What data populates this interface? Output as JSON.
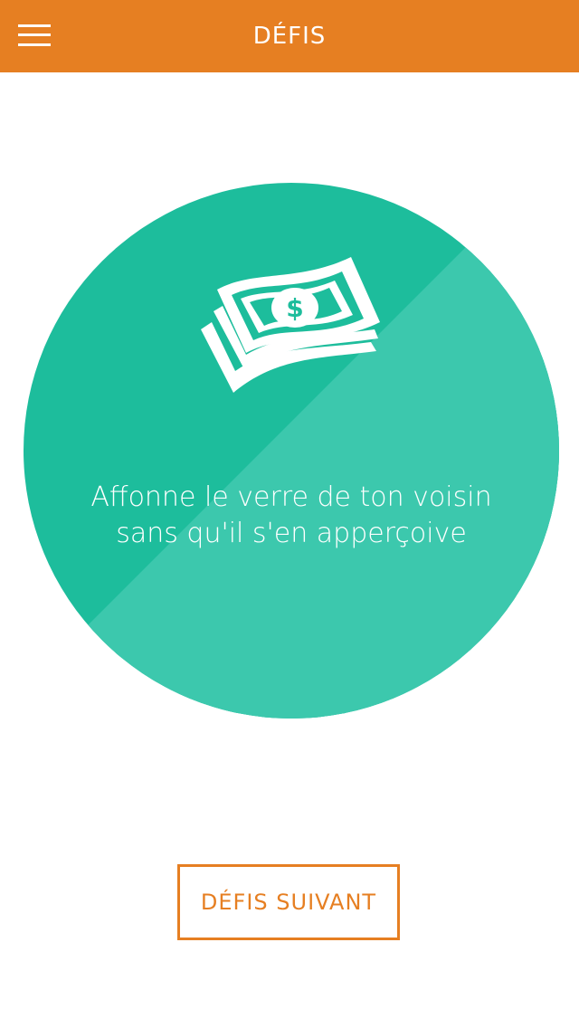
{
  "header": {
    "title": "DÉFIS",
    "menu_icon": "hamburger-menu-icon",
    "background_color": "#e67f22"
  },
  "challenge": {
    "icon": "money-bills-icon",
    "text": "Affonne le verre de ton voisin sans qu'il s'en apperçoive",
    "circle_color": "#1dbd9c",
    "circle_shade_color": "#3cc8ad"
  },
  "actions": {
    "next_label": "DÉFIS SUIVANT",
    "accent_color": "#e67f22"
  }
}
